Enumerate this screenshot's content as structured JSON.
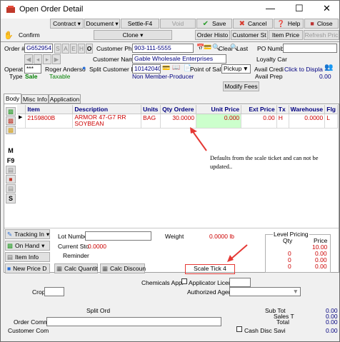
{
  "window": {
    "title": "Open Order Detail"
  },
  "menu": {
    "contract": "Contract",
    "document": "Document",
    "settle": "Settle-F4",
    "void": "Void",
    "save": "Save",
    "cancel": "Cancel",
    "help": "Help",
    "close": "Close"
  },
  "toolbar2": {
    "confirm": "Confirm",
    "clone": "Clone",
    "order_histo": "Order Histo",
    "customer_st": "Customer St",
    "item_price": "Item Price",
    "refresh_pric": "Refresh Pric"
  },
  "order": {
    "order_label": "Order #",
    "order_no": "G652954",
    "nav": [
      "S",
      "A",
      "E",
      "H",
      "O"
    ],
    "cust_phone_label": "Customer Pho",
    "cust_phone": "903-111-5555",
    "clear": "Clear",
    "last": "Last",
    "po_label": "PO Numb",
    "cust_name_label": "Customer Nam",
    "cust_name": "Gable Wholesale Enterprises",
    "loyalty_label": "Loyalty Car",
    "operat_label": "Operat",
    "operat_value": "***",
    "operator_name": "Roger Anderso",
    "split": "Split",
    "customer_id_label": "Customer I",
    "customer_id": "101420400",
    "pos_label": "Point of Sal",
    "pos_value": "Pickup",
    "avail_credit_label": "Avail Credi",
    "avail_credit_value": "Click to Displa",
    "type_label": "Type",
    "type_value": "Sale",
    "taxable": "Taxable",
    "producer": "Non Member-Producer",
    "avail_prep_label": "Avail Prep",
    "avail_prep_value": "0.00",
    "modify_fees": "Modify Fees"
  },
  "tabs": [
    "Body",
    "Misc Info",
    "Application"
  ],
  "side_letters": [
    "M",
    "F9",
    "S"
  ],
  "grid": {
    "columns": [
      "Item",
      "Description",
      "Units",
      "Qty Ordere",
      "Unit Price",
      "Ext Price",
      "Tx",
      "Warehouse",
      "Flg"
    ],
    "rows": [
      {
        "item": "2159800B",
        "description": "ARMOR 47-G7 RR SOYBEAN",
        "units": "BAG",
        "qty": "30.0000",
        "unit_price": "0.000",
        "ext_price": "0.00",
        "tx": "H",
        "warehouse": "0.0000",
        "flg": "L"
      }
    ]
  },
  "annotation": {
    "note": "Defaults from the scale ticket and can not be updated.."
  },
  "lower": {
    "tracking": "Tracking In",
    "on_hand": "On Hand",
    "item_info": "Item Info",
    "new_price": "New Price D",
    "lot_label": "Lot Number",
    "current_sto_label": "Current Sto",
    "current_sto_value": "0.0000",
    "reminder": "Reminder",
    "weight_label": "Weight",
    "weight_value": "0.0000 lb",
    "calc_quantity": "Calc Quantit",
    "calc_discount": "Calc Discoun",
    "scale_ticket": "Scale Tick 4",
    "level_pricing": "Level Pricing",
    "qty_header": "Qty",
    "price_header": "Price",
    "level_rows": [
      {
        "qty": "",
        "price": "10.00"
      },
      {
        "qty": "0",
        "price": "0.00"
      },
      {
        "qty": "0",
        "price": "0.00"
      },
      {
        "qty": "0",
        "price": "0.00"
      }
    ]
  },
  "footer": {
    "chemicals_label": "Chemicals Appl",
    "applicator": "Applicator Licens",
    "authorized_agent": "Authorized Agent",
    "crop_label": "Crop",
    "split_ord": "Split Ord",
    "sub_tot_label": "Sub Tot",
    "sub_tot": "0.00",
    "sales_t_label": "Sales T",
    "sales_t": "0.00",
    "total_label": "Total",
    "total": "0.00",
    "order_comm_label": "Order Comm",
    "customer_com_label": "Customer Com",
    "cash_disc_label": "Cash Disc Savi",
    "cash_disc": "0.00"
  }
}
